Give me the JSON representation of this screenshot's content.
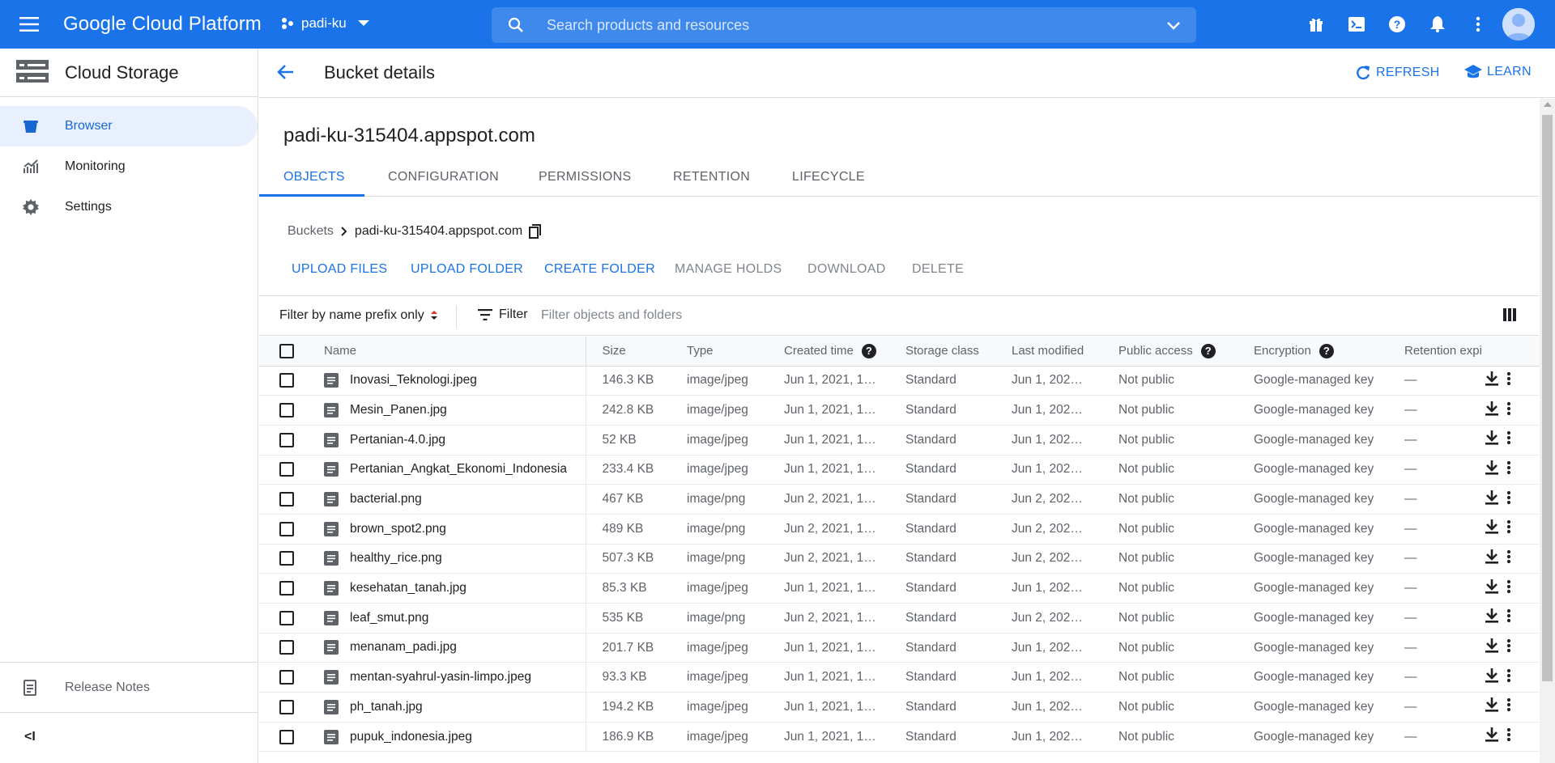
{
  "topbar": {
    "app_title": "Google Cloud Platform",
    "project_name": "padi-ku",
    "search_placeholder": "Search products and resources",
    "icons": [
      "gift-icon",
      "cloud-shell-icon",
      "help-icon",
      "notifications-icon",
      "more-vert-icon",
      "account-avatar"
    ]
  },
  "sidebar": {
    "product_title": "Cloud Storage",
    "items": [
      {
        "label": "Browser",
        "icon": "bucket-icon",
        "active": true
      },
      {
        "label": "Monitoring",
        "icon": "chart-icon",
        "active": false
      },
      {
        "label": "Settings",
        "icon": "gear-icon",
        "active": false
      }
    ],
    "release_notes": "Release Notes",
    "collapse_label": "<I"
  },
  "header": {
    "page_title": "Bucket details",
    "refresh_label": "REFRESH",
    "learn_label": "LEARN"
  },
  "bucket": {
    "name": "padi-ku-315404.appspot.com"
  },
  "tabs": [
    "OBJECTS",
    "CONFIGURATION",
    "PERMISSIONS",
    "RETENTION",
    "LIFECYCLE"
  ],
  "breadcrumb": {
    "root": "Buckets",
    "current": "padi-ku-315404.appspot.com"
  },
  "actions": {
    "upload_files": "UPLOAD FILES",
    "upload_folder": "UPLOAD FOLDER",
    "create_folder": "CREATE FOLDER",
    "manage_holds": "MANAGE HOLDS",
    "download": "DOWNLOAD",
    "delete": "DELETE"
  },
  "filter": {
    "prefix_label": "Filter by name prefix only",
    "filter_label": "Filter",
    "placeholder": "Filter objects and folders"
  },
  "table": {
    "columns": {
      "name": "Name",
      "size": "Size",
      "type": "Type",
      "created": "Created time",
      "storage_class": "Storage class",
      "last_modified": "Last modified",
      "public_access": "Public access",
      "encryption": "Encryption",
      "retention": "Retention expi"
    },
    "rows": [
      {
        "name": "Inovasi_Teknologi.jpeg",
        "size": "146.3 KB",
        "type": "image/jpeg",
        "created": "Jun 1, 2021, 1…",
        "storage_class": "Standard",
        "modified": "Jun 1, 202…",
        "access": "Not public",
        "encryption": "Google-managed key",
        "retention": "—"
      },
      {
        "name": "Mesin_Panen.jpg",
        "size": "242.8 KB",
        "type": "image/jpeg",
        "created": "Jun 1, 2021, 1…",
        "storage_class": "Standard",
        "modified": "Jun 1, 202…",
        "access": "Not public",
        "encryption": "Google-managed key",
        "retention": "—"
      },
      {
        "name": "Pertanian-4.0.jpg",
        "size": "52 KB",
        "type": "image/jpeg",
        "created": "Jun 1, 2021, 1…",
        "storage_class": "Standard",
        "modified": "Jun 1, 202…",
        "access": "Not public",
        "encryption": "Google-managed key",
        "retention": "—"
      },
      {
        "name": "Pertanian_Angkat_Ekonomi_Indonesia",
        "size": "233.4 KB",
        "type": "image/jpeg",
        "created": "Jun 1, 2021, 1…",
        "storage_class": "Standard",
        "modified": "Jun 1, 202…",
        "access": "Not public",
        "encryption": "Google-managed key",
        "retention": "—"
      },
      {
        "name": "bacterial.png",
        "size": "467 KB",
        "type": "image/png",
        "created": "Jun 2, 2021, 1…",
        "storage_class": "Standard",
        "modified": "Jun 2, 202…",
        "access": "Not public",
        "encryption": "Google-managed key",
        "retention": "—"
      },
      {
        "name": "brown_spot2.png",
        "size": "489 KB",
        "type": "image/png",
        "created": "Jun 2, 2021, 1…",
        "storage_class": "Standard",
        "modified": "Jun 2, 202…",
        "access": "Not public",
        "encryption": "Google-managed key",
        "retention": "—"
      },
      {
        "name": "healthy_rice.png",
        "size": "507.3 KB",
        "type": "image/png",
        "created": "Jun 2, 2021, 1…",
        "storage_class": "Standard",
        "modified": "Jun 2, 202…",
        "access": "Not public",
        "encryption": "Google-managed key",
        "retention": "—"
      },
      {
        "name": "kesehatan_tanah.jpg",
        "size": "85.3 KB",
        "type": "image/jpeg",
        "created": "Jun 1, 2021, 1…",
        "storage_class": "Standard",
        "modified": "Jun 1, 202…",
        "access": "Not public",
        "encryption": "Google-managed key",
        "retention": "—"
      },
      {
        "name": "leaf_smut.png",
        "size": "535 KB",
        "type": "image/png",
        "created": "Jun 2, 2021, 1…",
        "storage_class": "Standard",
        "modified": "Jun 2, 202…",
        "access": "Not public",
        "encryption": "Google-managed key",
        "retention": "—"
      },
      {
        "name": "menanam_padi.jpg",
        "size": "201.7 KB",
        "type": "image/jpeg",
        "created": "Jun 1, 2021, 1…",
        "storage_class": "Standard",
        "modified": "Jun 1, 202…",
        "access": "Not public",
        "encryption": "Google-managed key",
        "retention": "—"
      },
      {
        "name": "mentan-syahrul-yasin-limpo.jpeg",
        "size": "93.3 KB",
        "type": "image/jpeg",
        "created": "Jun 1, 2021, 1…",
        "storage_class": "Standard",
        "modified": "Jun 1, 202…",
        "access": "Not public",
        "encryption": "Google-managed key",
        "retention": "—"
      },
      {
        "name": "ph_tanah.jpg",
        "size": "194.2 KB",
        "type": "image/jpeg",
        "created": "Jun 1, 2021, 1…",
        "storage_class": "Standard",
        "modified": "Jun 1, 202…",
        "access": "Not public",
        "encryption": "Google-managed key",
        "retention": "—"
      },
      {
        "name": "pupuk_indonesia.jpeg",
        "size": "186.9 KB",
        "type": "image/jpeg",
        "created": "Jun 1, 2021, 1…",
        "storage_class": "Standard",
        "modified": "Jun 1, 202…",
        "access": "Not public",
        "encryption": "Google-managed key",
        "retention": "—"
      }
    ]
  },
  "colors": {
    "brand_blue": "#1a73e8",
    "active_bg": "#e8f0fe",
    "text_primary": "#202124",
    "text_secondary": "#5f6368"
  }
}
